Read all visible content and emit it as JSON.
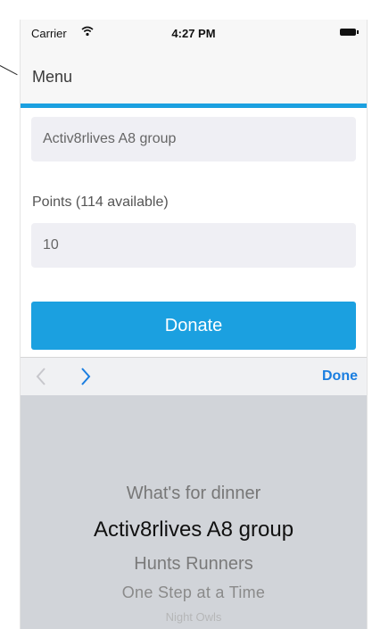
{
  "status_bar": {
    "carrier": "Carrier",
    "time": "4:27 PM"
  },
  "nav": {
    "title": "Menu"
  },
  "colors": {
    "accent": "#1ba0e0",
    "done_blue": "#1a7ee0",
    "picker_bg": "#d1d4d9"
  },
  "form": {
    "group_value": "Activ8rlives A8 group",
    "points_label": "Points (114 available)",
    "points_value": "10",
    "donate_label": "Donate"
  },
  "toolbar": {
    "prev_icon": "chevron-left-icon",
    "next_icon": "chevron-right-icon",
    "done_label": "Done"
  },
  "picker": {
    "items": [
      "What's for dinner",
      "Activ8rlives A8 group",
      "Hunts Runners",
      "One Step at a Time",
      "Night Owls"
    ],
    "selected": "Activ8rlives A8 group"
  }
}
